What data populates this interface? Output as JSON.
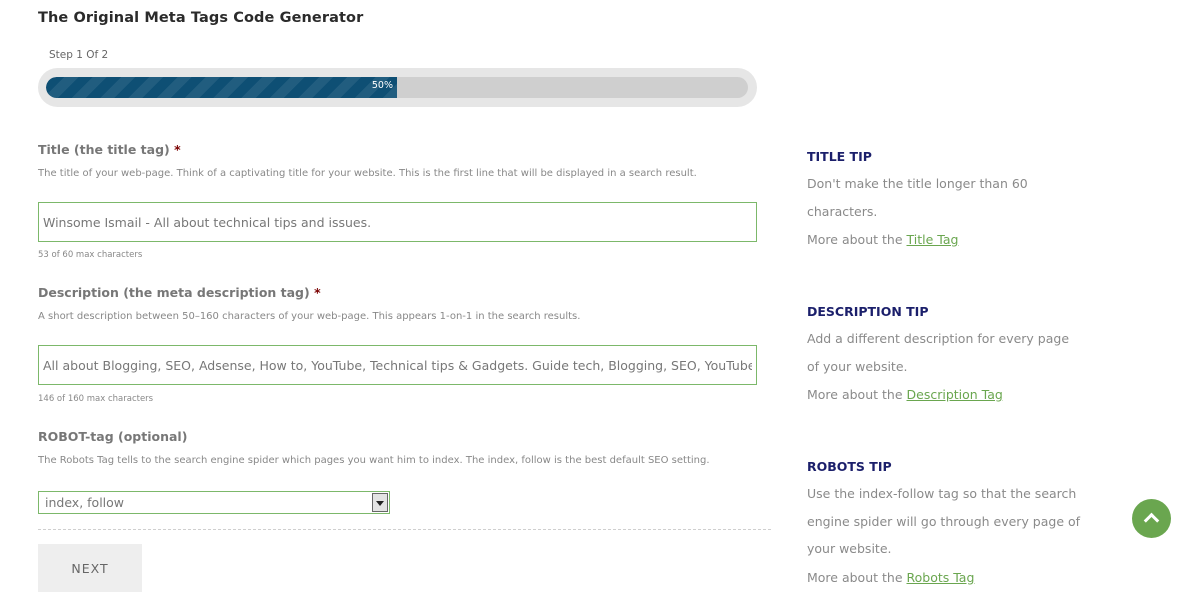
{
  "header": {
    "title": "The Original Meta Tags Code Generator"
  },
  "progress": {
    "step_label": "Step 1 Of 2",
    "percent_label": "50%",
    "fraction": 0.5
  },
  "title_field": {
    "label": "Title (the title tag)",
    "required_mark": "*",
    "help": "The title of your web-page. Think of a captivating title for your website. This is the first line that will be displayed in a search result.",
    "value": "Winsome Ismail - All about technical tips and issues.",
    "count": "53 of 60 max characters"
  },
  "description_field": {
    "label": "Description (the meta description tag)",
    "required_mark": "*",
    "help": "A short description between 50–160 characters of your web-page. This appears 1-on-1 in the search results.",
    "value": "All about Blogging, SEO, Adsense, How to, YouTube, Technical tips & Gadgets. Guide tech, Blogging, SEO, YouTube, w",
    "count": "146 of 160 max characters"
  },
  "robots_field": {
    "label": "ROBOT-tag (optional)",
    "help": "The Robots Tag tells to the search engine spider which pages you want him to index. The index, follow is the best default SEO setting.",
    "selected": "index, follow"
  },
  "next_button": {
    "label": "NEXT"
  },
  "tips": {
    "title": {
      "heading": "TITLE TIP",
      "text": "Don't make the title longer than 60 characters.",
      "more_prefix": "More about the ",
      "link": "Title Tag"
    },
    "description": {
      "heading": "DESCRIPTION TIP",
      "text": "Add a different description for every page of your website.",
      "more_prefix": "More about the ",
      "link": "Description Tag"
    },
    "robots": {
      "heading": "ROBOTS TIP",
      "text": "Use the index-follow tag so that the search engine spider will go through every page of your website.",
      "more_prefix": "More about the ",
      "link": "Robots Tag"
    }
  },
  "scroll_top": {
    "icon": "chevron-up-icon"
  },
  "colors": {
    "accent": "#6aa64f",
    "progress": "#0e4f74",
    "tip_heading": "#1b1f6b",
    "required": "#7a0000"
  }
}
